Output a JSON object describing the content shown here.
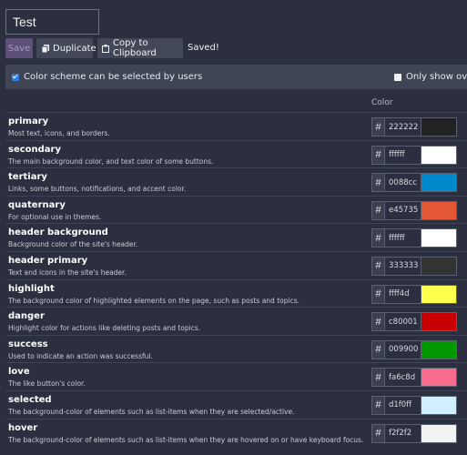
{
  "name_value": "Test",
  "toolbar": {
    "save_label": "Save",
    "duplicate_label": "Duplicate",
    "copy_label": "Copy to Clipboard",
    "status": "Saved!"
  },
  "options": {
    "user_selectable_label": "Color scheme can be selected by users",
    "overrides_label": "Only show overrides"
  },
  "table": {
    "color_header": "Color"
  },
  "colors": [
    {
      "name": "primary",
      "description": "Most text, icons, and borders.",
      "hex": "222222",
      "swatch": "#222222"
    },
    {
      "name": "secondary",
      "description": "The main background color, and text color of some buttons.",
      "hex": "ffffff",
      "swatch": "#ffffff"
    },
    {
      "name": "tertiary",
      "description": "Links, some buttons, notifications, and accent color.",
      "hex": "0088cc",
      "swatch": "#0088cc"
    },
    {
      "name": "quaternary",
      "description": "For optional use in themes.",
      "hex": "e45735",
      "swatch": "#e45735"
    },
    {
      "name": "header background",
      "description": "Background color of the site's header.",
      "hex": "ffffff",
      "swatch": "#ffffff"
    },
    {
      "name": "header primary",
      "description": "Text and icons in the site's header.",
      "hex": "333333",
      "swatch": "#333333"
    },
    {
      "name": "highlight",
      "description": "The background color of highlighted elements on the page, such as posts and topics.",
      "hex": "ffff4d",
      "swatch": "#ffff4d"
    },
    {
      "name": "danger",
      "description": "Highlight color for actions like deleting posts and topics.",
      "hex": "c80001",
      "swatch": "#c80001"
    },
    {
      "name": "success",
      "description": "Used to indicate an action was successful.",
      "hex": "009900",
      "swatch": "#009900"
    },
    {
      "name": "love",
      "description": "The like button's color.",
      "hex": "fa6c8d",
      "swatch": "#fa6c8d"
    },
    {
      "name": "selected",
      "description": "The background-color of elements such as list-items when they are selected/active.",
      "hex": "d1f0ff",
      "swatch": "#d1f0ff"
    },
    {
      "name": "hover",
      "description": "The background-color of elements such as list-items when they are hovered on or have keyboard focus.",
      "hex": "f2f2f2",
      "swatch": "#f2f2f2"
    }
  ]
}
